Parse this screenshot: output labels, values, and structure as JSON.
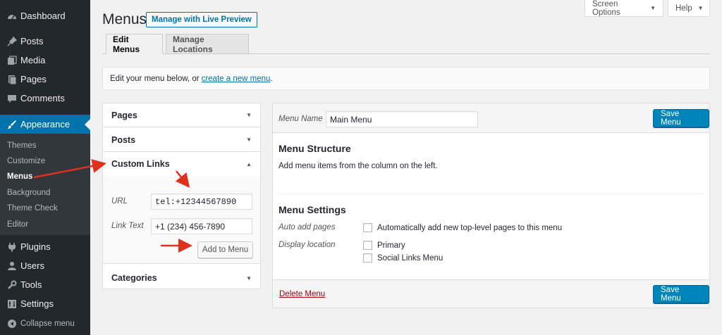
{
  "sidebar": {
    "items": [
      {
        "label": "Dashboard",
        "icon": "dashboard-icon"
      },
      {
        "label": "Posts",
        "icon": "pin-icon"
      },
      {
        "label": "Media",
        "icon": "media-icon"
      },
      {
        "label": "Pages",
        "icon": "page-icon"
      },
      {
        "label": "Comments",
        "icon": "comment-icon"
      },
      {
        "label": "Appearance",
        "icon": "brush-icon"
      },
      {
        "label": "Plugins",
        "icon": "plug-icon"
      },
      {
        "label": "Users",
        "icon": "user-icon"
      },
      {
        "label": "Tools",
        "icon": "wrench-icon"
      },
      {
        "label": "Settings",
        "icon": "settings-icon"
      },
      {
        "label": "Collapse menu",
        "icon": "collapse-icon"
      }
    ],
    "submenu": [
      "Themes",
      "Customize",
      "Menus",
      "Background",
      "Theme Check",
      "Editor"
    ],
    "accent": "#0073aa"
  },
  "header": {
    "title": "Menus",
    "live_preview": "Manage with Live Preview",
    "screen_options": "Screen Options",
    "help": "Help"
  },
  "tabs": [
    "Edit Menus",
    "Manage Locations"
  ],
  "notice": {
    "text": "Edit your menu below, or",
    "link": "create a new menu",
    "end": "."
  },
  "accordion": {
    "pages": "Pages",
    "posts": "Posts",
    "custom_links": "Custom Links",
    "categories": "Categories",
    "url_label": "URL",
    "url_value": "tel:+12344567890",
    "link_text_label": "Link Text",
    "link_text_value": "+1 (234) 456-7890",
    "add_button": "Add to Menu"
  },
  "menu_panel": {
    "name_label": "Menu Name",
    "name_value": "Main Menu",
    "save": "Save Menu",
    "structure_title": "Menu Structure",
    "structure_desc": "Add menu items from the column on the left.",
    "settings_title": "Menu Settings",
    "auto_add_label": "Auto add pages",
    "auto_add_option": "Automatically add new top-level pages to this menu",
    "display_label": "Display location",
    "locations": [
      "Primary",
      "Social Links Menu"
    ],
    "delete": "Delete Menu"
  },
  "annotation_color": "#e0301e"
}
